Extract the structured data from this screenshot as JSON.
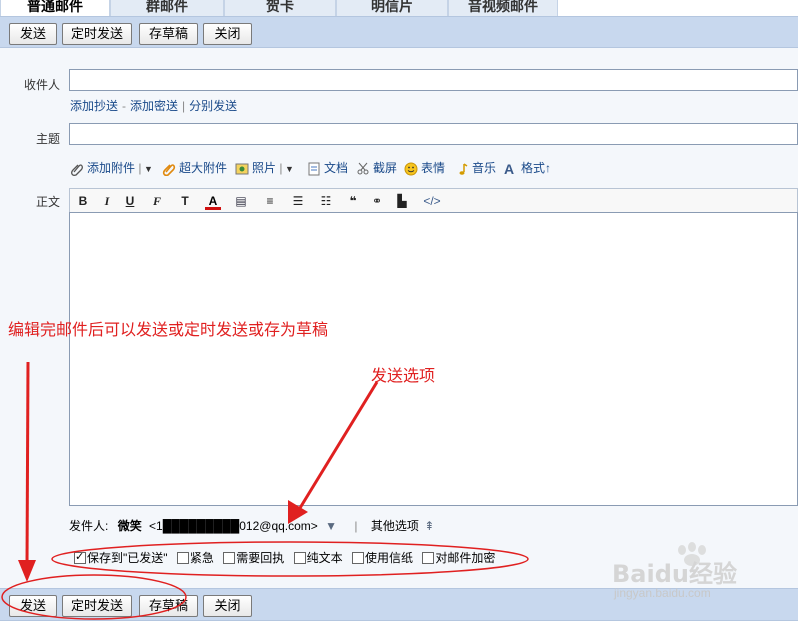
{
  "tabs": [
    "普通邮件",
    "群邮件",
    "贺卡",
    "明信片",
    "音视频邮件"
  ],
  "top_toolbar": {
    "send": "发送",
    "schedule": "定时发送",
    "draft": "存草稿",
    "close": "关闭"
  },
  "bottom_toolbar": {
    "send": "发送",
    "schedule": "定时发送",
    "draft": "存草稿",
    "close": "关闭"
  },
  "form": {
    "to_label": "收件人",
    "cc_links": {
      "cc": "添加抄送",
      "bcc": "添加密送",
      "separate": "分别发送"
    },
    "subject_label": "主题",
    "body_label": "正文",
    "attach": {
      "add_attachment": "添加附件",
      "large_attachment": "超大附件",
      "photo": "照片",
      "document": "文档",
      "screenshot": "截屏",
      "emoji": "表情",
      "music": "音乐",
      "format": "格式↑"
    },
    "editor_tools": [
      "B",
      "I",
      "U",
      "F",
      "T",
      "A",
      "▤",
      "≡",
      "☰",
      "☷",
      "❝",
      "⚭",
      "▙",
      "</>"
    ]
  },
  "sender": {
    "label": "发件人:",
    "name": "微笑",
    "email": "<1█████████012@qq.com>",
    "more_options": "其他选项"
  },
  "options": [
    {
      "label": "保存到\"已发送\"",
      "checked": true
    },
    {
      "label": "紧急",
      "checked": false
    },
    {
      "label": "需要回执",
      "checked": false
    },
    {
      "label": "纯文本",
      "checked": false
    },
    {
      "label": "使用信纸",
      "checked": false
    },
    {
      "label": "对邮件加密",
      "checked": false
    }
  ],
  "annotations": {
    "edit_hint": "编辑完邮件后可以发送或定时发送或存为草稿",
    "send_options": "发送选项"
  },
  "watermark": {
    "brand": "Baidu经验",
    "url": "jingyan.baidu.com"
  },
  "colors": {
    "annotation": "#e02020",
    "toolbar": "#c8d8ee",
    "link": "#1a4a8a"
  }
}
